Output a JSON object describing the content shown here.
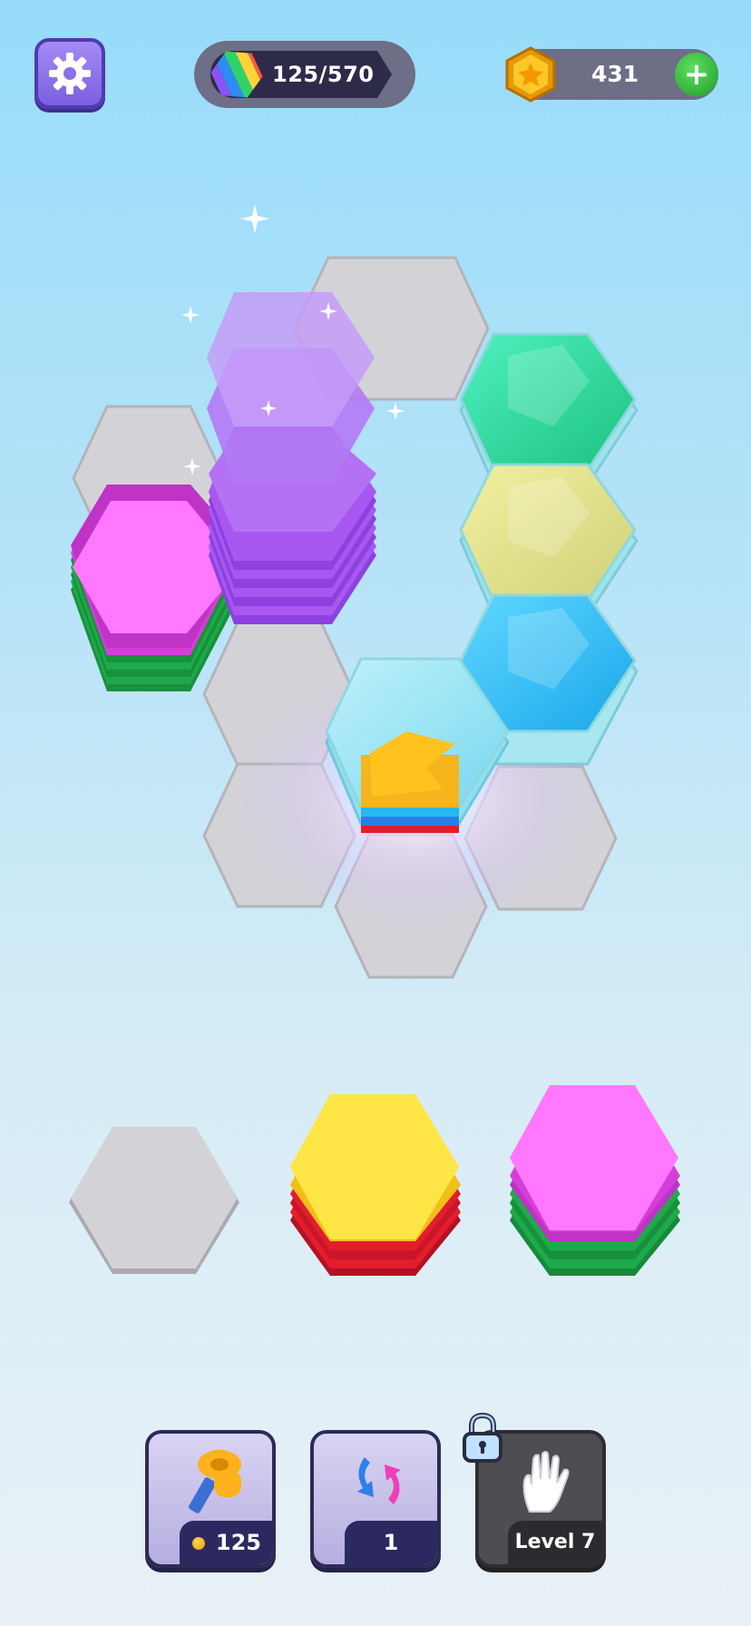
{
  "hud": {
    "progress_text": "125/570",
    "progress_fraction": 0.219,
    "coins": "431",
    "plus_label": "+"
  },
  "icons": {
    "settings": "gear-icon",
    "progress": "rainbow-hex-icon",
    "coin": "star-coin-icon",
    "add": "plus-icon",
    "hammer": "hammer-icon",
    "shuffle": "shuffle-arrows-icon",
    "hand": "glove-hand-icon",
    "lock": "padlock-icon"
  },
  "tray": [
    {
      "label": "empty-slot"
    },
    {
      "label": "yellow-red-stack",
      "layers": [
        "#e31c2e",
        "#e31c2e",
        "#e31c2e",
        "#f5c21c",
        "#ffe545"
      ]
    },
    {
      "label": "magenta-green-stack",
      "layers": [
        "#1faa4a",
        "#1faa4a",
        "#1faa4a",
        "#1faa4a",
        "#d33ed8",
        "#ff78ff"
      ]
    }
  ],
  "boosters": [
    {
      "name": "hammer",
      "label": "125",
      "locked": false
    },
    {
      "name": "shuffle",
      "label": "1",
      "locked": false
    },
    {
      "name": "hand",
      "label": "Level 7",
      "locked": true
    }
  ],
  "colors": {
    "purple_stack": "#a85cf0",
    "magenta": "#ff78ff",
    "green": "#1faa4a",
    "yellow": "#ffe545",
    "red": "#e31c2e",
    "empty_cell": "#d2d2d6",
    "accent_purple": "#7a5fe0"
  }
}
